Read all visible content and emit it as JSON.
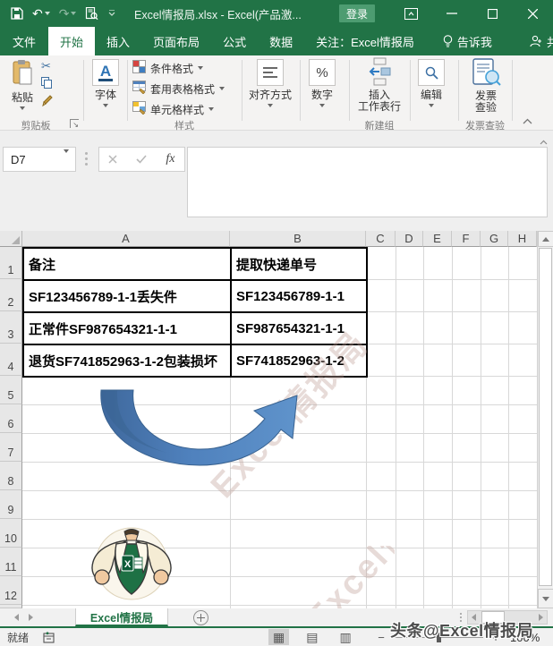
{
  "colors": {
    "excel_green": "#217346",
    "login_green": "#4d9c71",
    "arrow_blue_dark": "#41689b",
    "arrow_blue_light": "#5b8fc7",
    "active_tab_text": "#217346"
  },
  "icons": {
    "undo": "↶",
    "redo": "↷",
    "scissors": "✂",
    "launcher_arrow": "↘",
    "view_normal": "▦",
    "view_layout": "▤",
    "view_break": "▥",
    "minus": "−",
    "plus": "+",
    "collapse_chevron": "∧",
    "formula_collapse": "∧"
  },
  "titlebar": {
    "title": "Excel情报局.xlsx  -  Excel(产品激...",
    "login": "登录"
  },
  "tabs": {
    "file": "文件",
    "home": "开始",
    "insert": "插入",
    "page_layout": "页面布局",
    "formulas": "公式",
    "data": "数据",
    "follow": "关注：Excel情报局",
    "tell_me": "告诉我",
    "share": "共享"
  },
  "ribbon": {
    "paste": "粘贴",
    "clipboard_group": "剪贴板",
    "font": "字体",
    "font_icon_letter": "A",
    "conditional_format": "条件格式",
    "table_format": "套用表格格式",
    "cell_styles": "单元格样式",
    "styles_group": "样式",
    "alignment": "对齐方式",
    "number": "数字",
    "number_icon": "%",
    "insert_row_line1": "插入",
    "insert_row_line2": "工作表行",
    "new_group": "新建组",
    "edit": "编辑",
    "invoice_line1": "发票",
    "invoice_line2": "查验",
    "invoice_group": "发票查验"
  },
  "formula_bar": {
    "name_box": "D7",
    "fx_label": "fx",
    "value": ""
  },
  "grid": {
    "columns": [
      "A",
      "B",
      "C",
      "D",
      "E",
      "F",
      "G",
      "H"
    ],
    "rows": [
      "1",
      "2",
      "3",
      "4",
      "5",
      "6",
      "7",
      "8",
      "9",
      "10",
      "11",
      "12"
    ],
    "table": {
      "headers": [
        "备注",
        "提取快递单号"
      ],
      "rows": [
        [
          "SF123456789-1-1丢失件",
          "SF123456789-1-1"
        ],
        [
          "正常件SF987654321-1-1",
          "SF987654321-1-1"
        ],
        [
          "退货SF741852963-1-2包装损坏",
          "SF741852963-1-2"
        ]
      ]
    },
    "watermark": "Excel情报局"
  },
  "sheet_bar": {
    "active_tab": "Excel情报局"
  },
  "status_bar": {
    "ready": "就绪",
    "zoom_level": "100%"
  },
  "overlay_watermark": "头条@Excel情报局"
}
